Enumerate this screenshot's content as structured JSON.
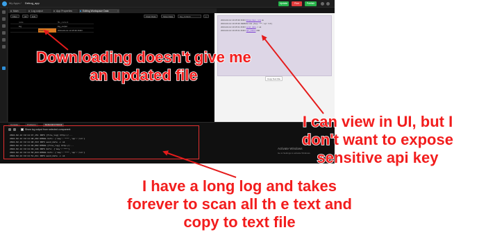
{
  "app": {
    "breadcrumb": "My Apps /",
    "app_name": "Debug_app",
    "buttons": {
      "update": "Update",
      "run": "Run",
      "publish": "Publish"
    },
    "tabs": [
      {
        "label": "Main"
      },
      {
        "label": "Log output"
      },
      {
        "label": "App Properties"
      },
      {
        "label": "Editing Workspace Data"
      }
    ],
    "canvas_toolbar": {
      "buttons": [
        "Filter",
        "All",
        "Edit"
      ],
      "right_buttons": [
        "Clear Data",
        "Save Data"
      ],
      "input_value": "log_content",
      "add_button": "+"
    },
    "grid": {
      "headers": [
        "",
        "node",
        "file_content"
      ],
      "rows": [
        [
          "",
          "log",
          "log_output"
        ],
        [
          "",
          "Click...",
          "2024-02-12 13:15:30 INFO"
        ]
      ]
    },
    "preview": {
      "lines": [
        {
          "prefix": "2024-02-12 19:15:30 INFO",
          "link": "[https://api.../v1]",
          "suffix": " ok"
        },
        {
          "prefix": "2024-02-12 19:15:30 DEBUG Info: {'key': '***', 'ep': '/v1'}",
          "link": "",
          "suffix": ""
        },
        {
          "prefix": "2024-02-12 19:15:31 INFO ",
          "link": "send_data",
          "suffix": " -> ok"
        },
        {
          "prefix": "2024-02-12 19:15:31 INFO ",
          "link": "api_status",
          "suffix": " 200"
        }
      ],
      "button": "Copy Text File"
    },
    "console": {
      "tabs": [
        "Console",
        "Problems",
        "Debugging Output"
      ],
      "toggle_label": "Show log output from selected component",
      "lines": [
        "2024-02-12 19:11:47,151 INFO     [file_log] http://...",
        "2024-02-12 19:11:48,202 DEBUG    Info: {'key':'***','ep':'/v1'}",
        "2024-02-12 19:11:48,310 INFO     send_data -> ok",
        "2024-02-12 19:11:49,002 DEBUG    [file_log] http://...",
        "2024-02-12 19:11:49,144 INFO     Info: {'key':'***'}",
        "2024-02-12 19:11:50,018 DEBUG    Info: {'key':'***','ep':'/v1'}",
        "2024-02-12 19:11:51,211 INFO     send_data -> ok"
      ]
    },
    "watermark": {
      "title": "Activate Windows",
      "subtitle": "Go to Settings to activate Windows."
    }
  },
  "annotations": {
    "callout_download": [
      "Downloading doesn't give me",
      "an updated file"
    ],
    "callout_view": [
      "I can view in UI, but I",
      "don't want to expose",
      "sensitive api key"
    ],
    "callout_log": [
      "I have a long log and takes",
      "forever to scan all th e text and",
      "copy to text file"
    ]
  },
  "colors": {
    "annotation": "#f21d1d",
    "accent": "#3aa0e8",
    "update": "#25b24a",
    "run": "#e23d3d"
  }
}
